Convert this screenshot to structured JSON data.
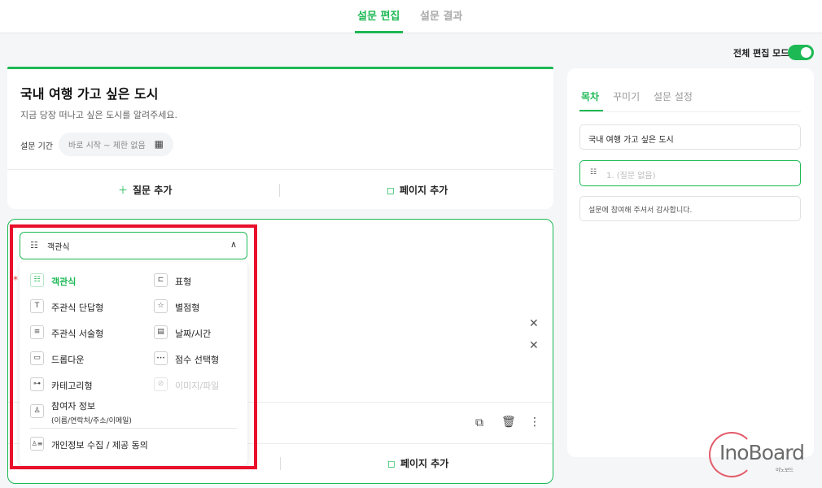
{
  "top_tabs": [
    {
      "label": "설문 편집",
      "active": true
    },
    {
      "label": "설문 결과",
      "active": false
    }
  ],
  "edit_mode": {
    "label": "전체 편집 모드",
    "on": true
  },
  "survey": {
    "title": "국내 여행 가고 싶은 도시",
    "description": "지금 당장 떠나고 싶은 도시를 알려주세요.",
    "period_label": "설문 기간",
    "period_value": "바로 시작 ~ 제한 없음"
  },
  "actions": {
    "add_question": "질문 추가",
    "add_page": "페이지 추가"
  },
  "question": {
    "selected_type": "객관식",
    "required_mark": "*"
  },
  "type_menu": [
    {
      "label": "객관식",
      "icon": "list-check-icon",
      "glyph": "☷",
      "active": true,
      "disabled": false
    },
    {
      "label": "표형",
      "icon": "table-icon",
      "glyph": "⊏",
      "active": false,
      "disabled": false
    },
    {
      "label": "주관식 단답형",
      "icon": "text-icon",
      "glyph": "T",
      "active": false,
      "disabled": false
    },
    {
      "label": "별점형",
      "icon": "star-icon",
      "glyph": "☆",
      "active": false,
      "disabled": false
    },
    {
      "label": "주관식 서술형",
      "icon": "paragraph-icon",
      "glyph": "≡",
      "active": false,
      "disabled": false
    },
    {
      "label": "날짜/시간",
      "icon": "calendar-icon",
      "glyph": "▤",
      "active": false,
      "disabled": false
    },
    {
      "label": "드롭다운",
      "icon": "dropdown-icon",
      "glyph": "▭",
      "active": false,
      "disabled": false
    },
    {
      "label": "점수 선택형",
      "icon": "dots-icon",
      "glyph": "•••",
      "active": false,
      "disabled": false
    },
    {
      "label": "카테고리형",
      "icon": "category-icon",
      "glyph": "⊶",
      "active": false,
      "disabled": false
    },
    {
      "label": "이미지/파일",
      "icon": "attachment-icon",
      "glyph": "⊘",
      "active": false,
      "disabled": true
    }
  ],
  "participant_info": {
    "label": "참여자 정보",
    "sub": "(이름/연락처/주소/이메일)",
    "icon": "person-icon"
  },
  "consent": {
    "label": "개인정보 수집 / 제공 동의",
    "icon": "consent-icon"
  },
  "side_tabs": [
    {
      "label": "목차",
      "active": true
    },
    {
      "label": "꾸미기",
      "active": false
    },
    {
      "label": "설문 설정",
      "active": false
    }
  ],
  "toc": {
    "title_item": "국내 여행 가고 싶은 도시",
    "question_item": "1. (질문 없음)",
    "end_item": "설문에 참여해 주셔서 감사합니다."
  },
  "logo": {
    "text": "InoBoard",
    "sub": "이노보드"
  },
  "colors": {
    "accent": "#1db954",
    "highlight": "#e8102b"
  }
}
